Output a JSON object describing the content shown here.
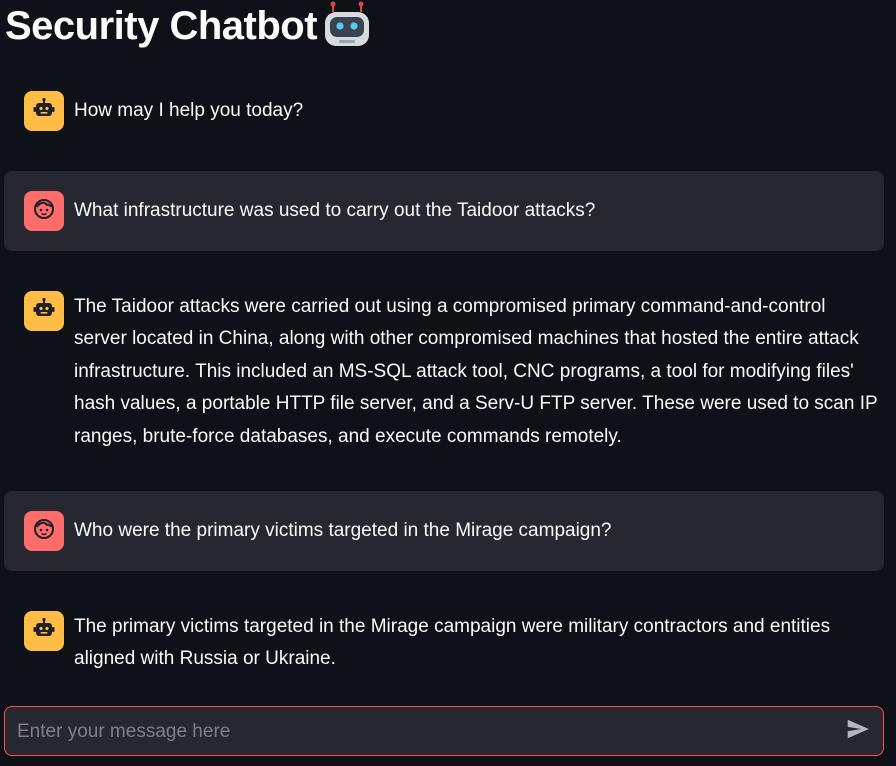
{
  "header": {
    "title": "Security Chatbot",
    "title_emoji": "robot-face-icon"
  },
  "messages": [
    {
      "role": "assistant",
      "avatar": "bot-icon",
      "text": "How may I help you today?"
    },
    {
      "role": "user",
      "avatar": "user-face-icon",
      "text": "What infrastructure was used to carry out the Taidoor attacks?"
    },
    {
      "role": "assistant",
      "avatar": "bot-icon",
      "text": "The Taidoor attacks were carried out using a compromised primary command-and-control server located in China, along with other compromised machines that hosted the entire attack infrastructure. This included an MS-SQL attack tool, CNC programs, a tool for modifying files' hash values, a portable HTTP file server, and a Serv-U FTP server. These were used to scan IP ranges, brute-force databases, and execute commands remotely."
    },
    {
      "role": "user",
      "avatar": "user-face-icon",
      "text": "Who were the primary victims targeted in the Mirage campaign?"
    },
    {
      "role": "assistant",
      "avatar": "bot-icon",
      "text": "The primary victims targeted in the Mirage campaign were military contractors and entities aligned with Russia or Ukraine."
    }
  ],
  "chat_input": {
    "placeholder": "Enter your message here",
    "value": "",
    "send_icon": "send-icon"
  },
  "colors": {
    "background": "#0e1117",
    "user_message_bg": "#262730",
    "bot_avatar": "#ffbd45",
    "user_avatar": "#ff6c6c",
    "input_border": "#ff4b4b",
    "text": "#fafafa"
  }
}
